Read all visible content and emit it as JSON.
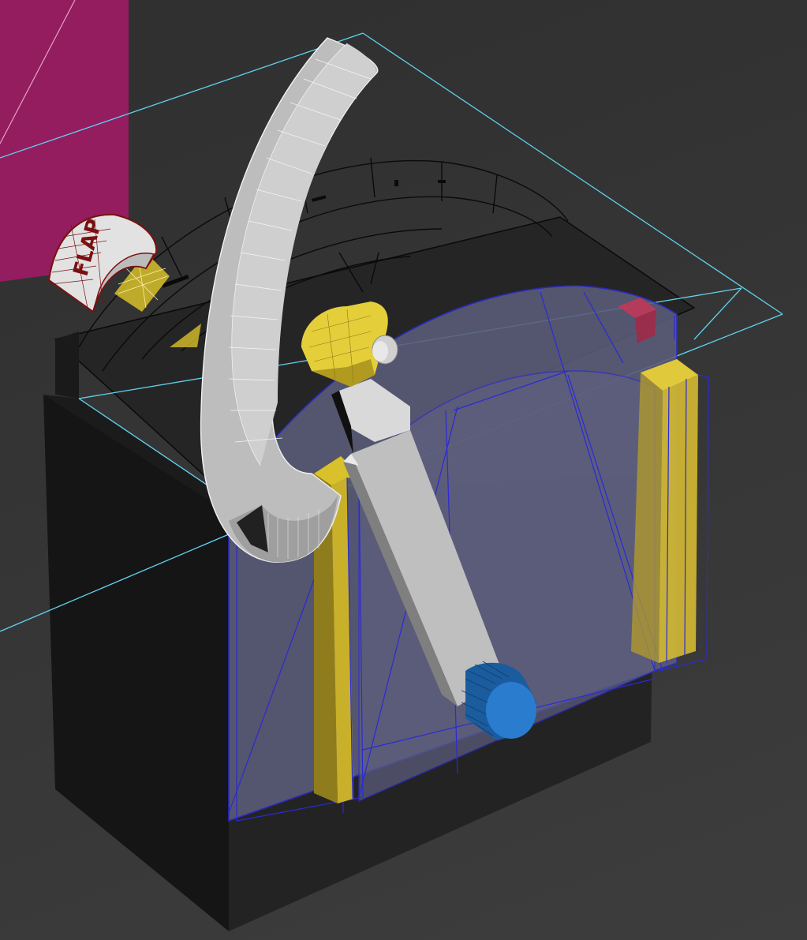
{
  "scene": {
    "flap_lever_knob_label": "FLAP",
    "colors": {
      "background": "#353535",
      "magenta_wall": "#931d5f",
      "housing_dark": "#1f1f1f",
      "housing_top": "#262626",
      "wire_black": "#0a0a0a",
      "glass_panel": "#5b5c7a",
      "glass_edge": "#2a2ad8",
      "guide_rail_yellow": "#d8c12a",
      "lever_grey": "#c9c9c9",
      "knob_blue": "#1d6fc0",
      "selection_cyan": "#5fd3f0",
      "marker_red": "#c0395a",
      "flap_knob_outline": "#7a1010"
    },
    "icons": [
      "flap-knob-icon",
      "lever-arm-icon",
      "blue-knob-icon"
    ]
  }
}
